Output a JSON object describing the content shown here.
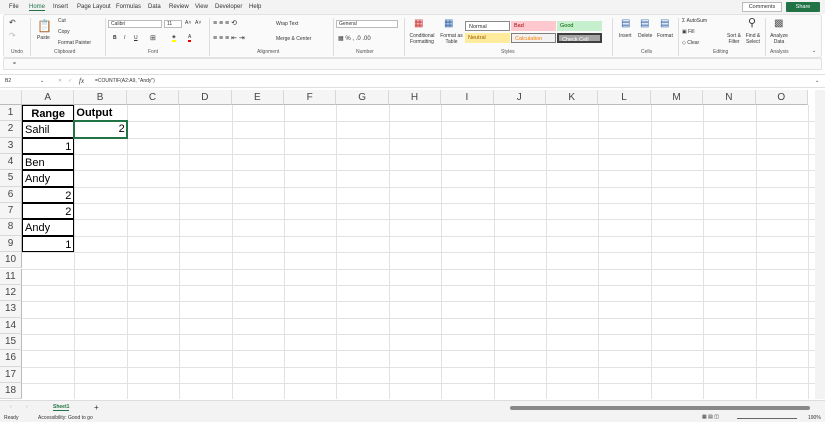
{
  "menu": [
    "File",
    "Home",
    "Insert",
    "Page Layout",
    "Formulas",
    "Data",
    "Review",
    "View",
    "Developer",
    "Help"
  ],
  "actions": {
    "comments": "Comments",
    "share": "Share"
  },
  "ribbon": {
    "undo_group": "Undo",
    "clipboard": {
      "paste": "Paste",
      "cut": "Cut",
      "copy": "Copy",
      "format_painter": "Format Painter",
      "label": "Clipboard"
    },
    "font": {
      "name": "Calibri",
      "size": "11",
      "bold": "B",
      "italic": "I",
      "underline": "U",
      "label": "Font"
    },
    "alignment": {
      "wrap": "Wrap Text",
      "merge": "Merge & Center",
      "label": "Alignment"
    },
    "number": {
      "format": "General",
      "label": "Number"
    },
    "styles": {
      "conditional": "Conditional Formatting",
      "format_table": "Format as Table",
      "normal": "Normal",
      "bad": "Bad",
      "good": "Good",
      "neutral": "Neutral",
      "calculation": "Calculation",
      "check_cell": "Check Cell",
      "label": "Styles"
    },
    "cells": {
      "insert": "Insert",
      "delete": "Delete",
      "format": "Format",
      "label": "Cells"
    },
    "editing": {
      "autosum": "AutoSum",
      "fill": "Fill",
      "clear": "Clear",
      "sort": "Sort & Filter",
      "find": "Find & Select",
      "label": "Editing"
    },
    "analysis": {
      "analyze": "Analyze Data",
      "label": "Analysis"
    }
  },
  "qa_text": "=",
  "formula_bar": {
    "name_box": "B2",
    "fx": "fx",
    "formula": "=COUNTIF(A2:A9, \"Andy\")"
  },
  "columns": [
    "A",
    "B",
    "C",
    "D",
    "E",
    "F",
    "G",
    "H",
    "I",
    "J",
    "K",
    "L",
    "M",
    "N",
    "O"
  ],
  "rows": [
    "1",
    "2",
    "3",
    "4",
    "5",
    "6",
    "7",
    "8",
    "9",
    "10",
    "11",
    "12",
    "13",
    "14",
    "15",
    "16",
    "17",
    "18"
  ],
  "cells": {
    "A1": "Range",
    "B1": "Output",
    "A2": "Sahil",
    "B2": "2",
    "A3": "1",
    "A4": "Ben",
    "A5": "Andy",
    "A6": "2",
    "A7": "2",
    "A8": "Andy",
    "A9": "1"
  },
  "sheet_tab": "Sheet1",
  "status": {
    "ready": "Ready",
    "accessibility": "Accessibility: Good to go",
    "zoom": "190%"
  }
}
